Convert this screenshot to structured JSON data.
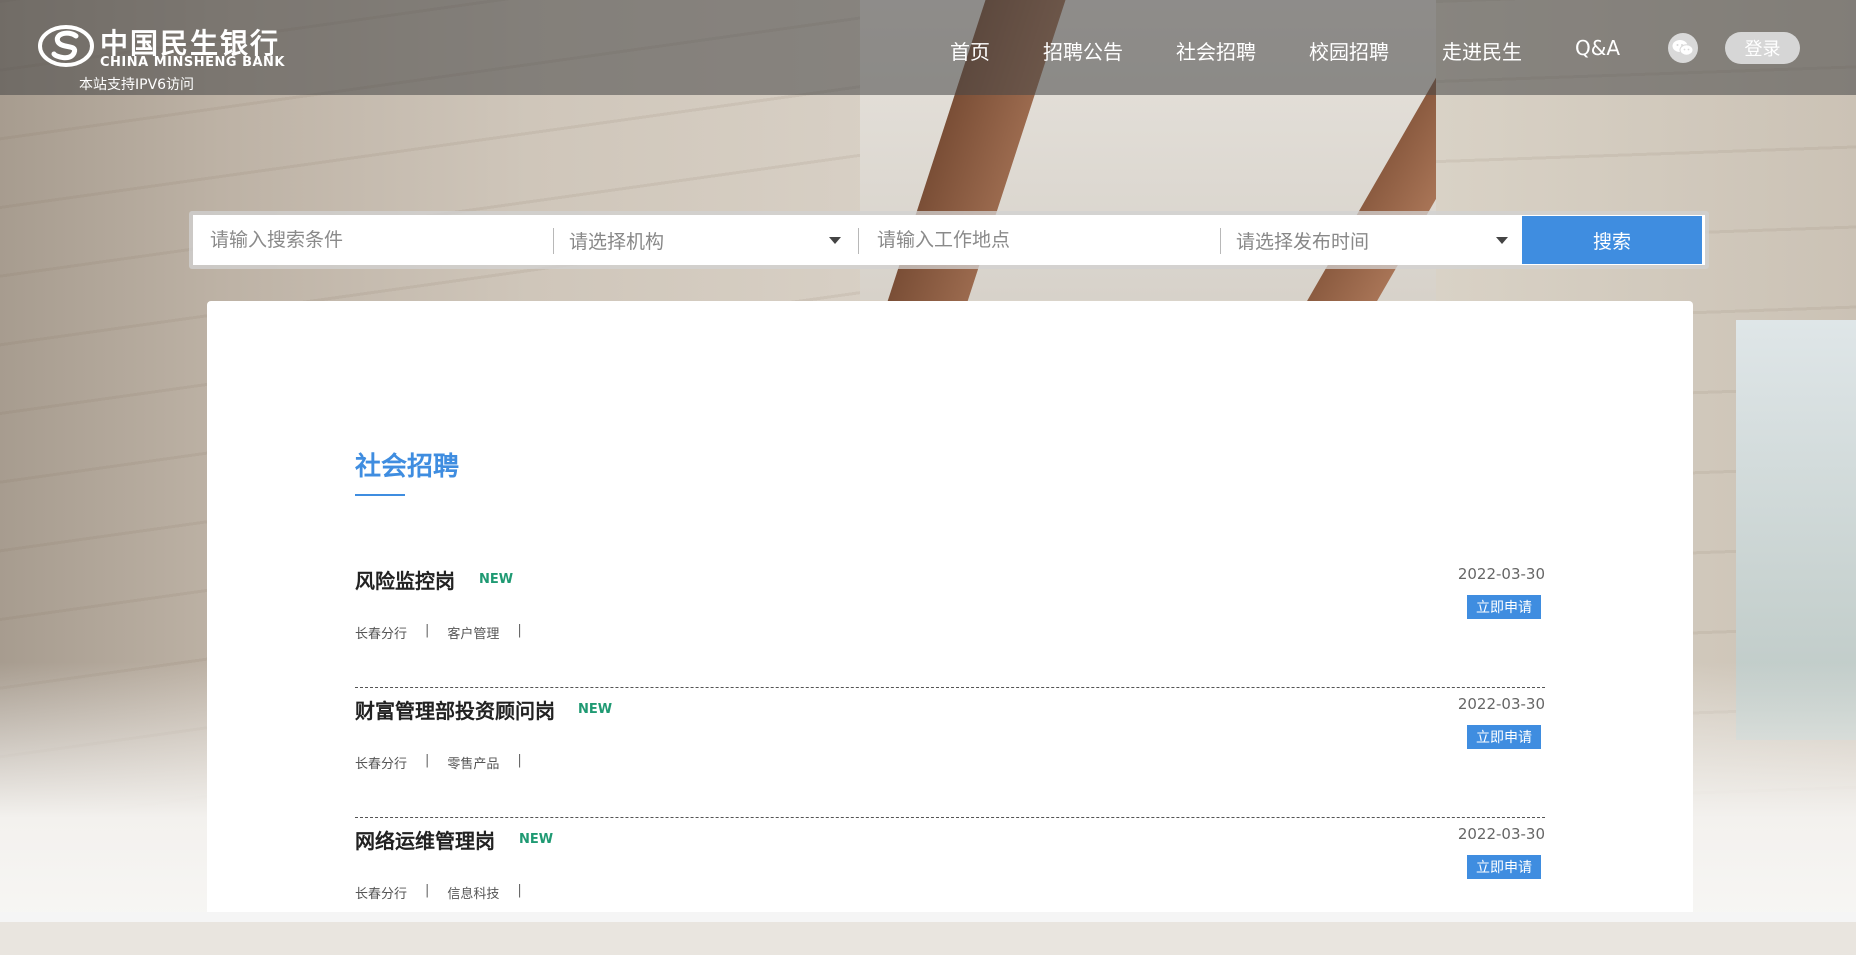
{
  "header": {
    "logo_cn": "中国民生银行",
    "logo_en": "CHINA MINSHENG BANK",
    "ipv6_note": "本站支持IPV6访问",
    "nav": [
      {
        "label": "首页"
      },
      {
        "label": "招聘公告"
      },
      {
        "label": "社会招聘"
      },
      {
        "label": "校园招聘"
      },
      {
        "label": "走进民生"
      },
      {
        "label": "Q&A"
      }
    ],
    "wechat_icon": "wechat-icon",
    "login_label": "登录"
  },
  "search": {
    "keyword_placeholder": "请输入搜索条件",
    "org_placeholder": "请选择机构",
    "location_placeholder": "请输入工作地点",
    "time_placeholder": "请选择发布时间",
    "button_label": "搜索"
  },
  "main": {
    "section_title": "社会招聘",
    "jobs": [
      {
        "title": "风险监控岗",
        "badge": "NEW",
        "branch": "长春分行",
        "category": "客户管理",
        "date": "2022-03-30",
        "apply_label": "立即申请"
      },
      {
        "title": "财富管理部投资顾问岗",
        "badge": "NEW",
        "branch": "长春分行",
        "category": "零售产品",
        "date": "2022-03-30",
        "apply_label": "立即申请"
      },
      {
        "title": "网络运维管理岗",
        "badge": "NEW",
        "branch": "长春分行",
        "category": "信息科技",
        "date": "2022-03-30",
        "apply_label": "立即申请"
      }
    ]
  },
  "colors": {
    "accent": "#3f8de0",
    "new_badge": "#1f9a73",
    "header_overlay": "#464646"
  }
}
